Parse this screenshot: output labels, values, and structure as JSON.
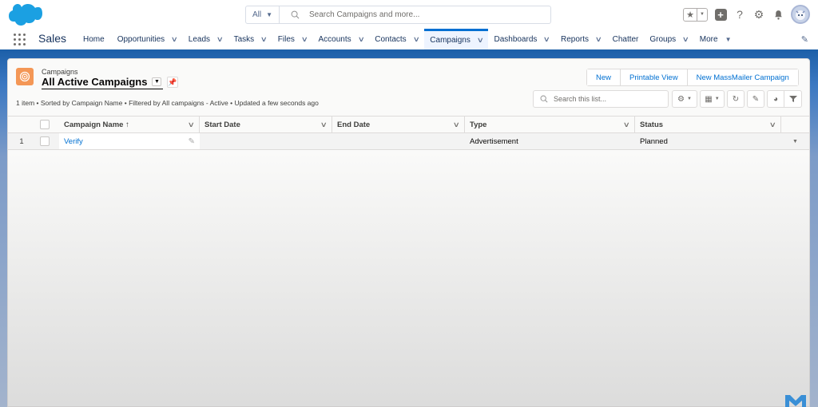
{
  "header": {
    "search_scope": "All",
    "search_placeholder": "Search Campaigns and more...",
    "icons": [
      "salesforce-cloud-logo",
      "favorites-star-icon",
      "favorites-dropdown-icon",
      "global-actions-plus-icon",
      "help-icon",
      "setup-gear-icon",
      "notifications-bell-icon",
      "user-avatar"
    ]
  },
  "nav": {
    "app_name": "Sales",
    "items": [
      {
        "label": "Home",
        "dropdown": false
      },
      {
        "label": "Opportunities",
        "dropdown": true
      },
      {
        "label": "Leads",
        "dropdown": true
      },
      {
        "label": "Tasks",
        "dropdown": true
      },
      {
        "label": "Files",
        "dropdown": true
      },
      {
        "label": "Accounts",
        "dropdown": true
      },
      {
        "label": "Contacts",
        "dropdown": true
      },
      {
        "label": "Campaigns",
        "dropdown": true,
        "active": true
      },
      {
        "label": "Dashboards",
        "dropdown": true
      },
      {
        "label": "Reports",
        "dropdown": true
      },
      {
        "label": "Chatter",
        "dropdown": false
      },
      {
        "label": "Groups",
        "dropdown": true
      },
      {
        "label": "More",
        "dropdown": true
      }
    ]
  },
  "list_view": {
    "object_label": "Campaigns",
    "title": "All Active Campaigns",
    "meta": "1 item • Sorted by Campaign Name • Filtered by All campaigns - Active • Updated a few seconds ago",
    "buttons": {
      "new": "New",
      "printable": "Printable View",
      "massmailer": "New MassMailer Campaign"
    },
    "search_placeholder": "Search this list...",
    "columns": [
      "Campaign Name",
      "Start Date",
      "End Date",
      "Type",
      "Status"
    ],
    "sort_indicator": "↑",
    "rows": [
      {
        "num": "1",
        "name": "Verify",
        "start": "",
        "end": "",
        "type": "Advertisement",
        "status": "Planned"
      }
    ]
  },
  "colors": {
    "brand_blue": "#0070d2",
    "object_icon": "#f49756",
    "nav_active_bar": "#0070d2"
  }
}
